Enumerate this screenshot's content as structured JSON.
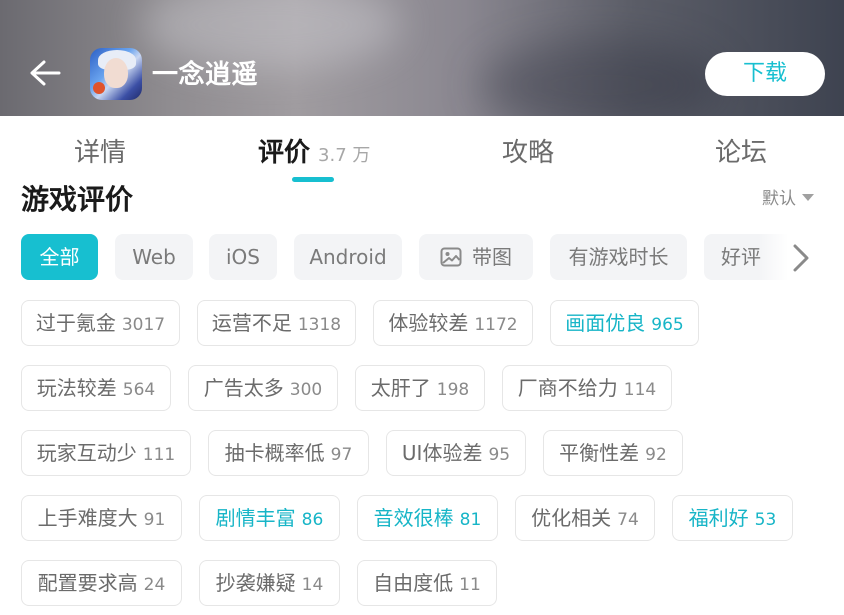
{
  "header": {
    "title": "一念逍遥",
    "download_label": "下载"
  },
  "tabs": [
    {
      "label": "详情",
      "count": ""
    },
    {
      "label": "评价",
      "count": "3.7 万"
    },
    {
      "label": "攻略",
      "count": ""
    },
    {
      "label": "论坛",
      "count": ""
    }
  ],
  "section": {
    "title": "游戏评价",
    "sort_label": "默认"
  },
  "filters": [
    "全部",
    "Web",
    "iOS",
    "Android",
    "带图",
    "有游戏时长",
    "好评"
  ],
  "tags": [
    {
      "label": "过于氪金",
      "count": "3017",
      "highlight": false
    },
    {
      "label": "运营不足",
      "count": "1318",
      "highlight": false
    },
    {
      "label": "体验较差",
      "count": "1172",
      "highlight": false
    },
    {
      "label": "画面优良",
      "count": "965",
      "highlight": true
    },
    {
      "label": "玩法较差",
      "count": "564",
      "highlight": false
    },
    {
      "label": "广告太多",
      "count": "300",
      "highlight": false
    },
    {
      "label": "太肝了",
      "count": "198",
      "highlight": false
    },
    {
      "label": "厂商不给力",
      "count": "114",
      "highlight": false
    },
    {
      "label": "玩家互动少",
      "count": "111",
      "highlight": false
    },
    {
      "label": "抽卡概率低",
      "count": "97",
      "highlight": false
    },
    {
      "label": "UI体验差",
      "count": "95",
      "highlight": false
    },
    {
      "label": "平衡性差",
      "count": "92",
      "highlight": false
    },
    {
      "label": "上手难度大",
      "count": "91",
      "highlight": false
    },
    {
      "label": "剧情丰富",
      "count": "86",
      "highlight": true
    },
    {
      "label": "音效很棒",
      "count": "81",
      "highlight": true
    },
    {
      "label": "优化相关",
      "count": "74",
      "highlight": false
    },
    {
      "label": "福利好",
      "count": "53",
      "highlight": true
    },
    {
      "label": "配置要求高",
      "count": "24",
      "highlight": false
    },
    {
      "label": "抄袭嫌疑",
      "count": "14",
      "highlight": false
    },
    {
      "label": "自由度低",
      "count": "11",
      "highlight": false
    }
  ],
  "icons": {
    "back": "arrow-left-icon",
    "image": "image-icon",
    "sort": "caret-down-icon",
    "more": "chevron-right-icon"
  },
  "colors": {
    "accent": "#17bfd0",
    "tag_highlight": "#17b5c7"
  }
}
